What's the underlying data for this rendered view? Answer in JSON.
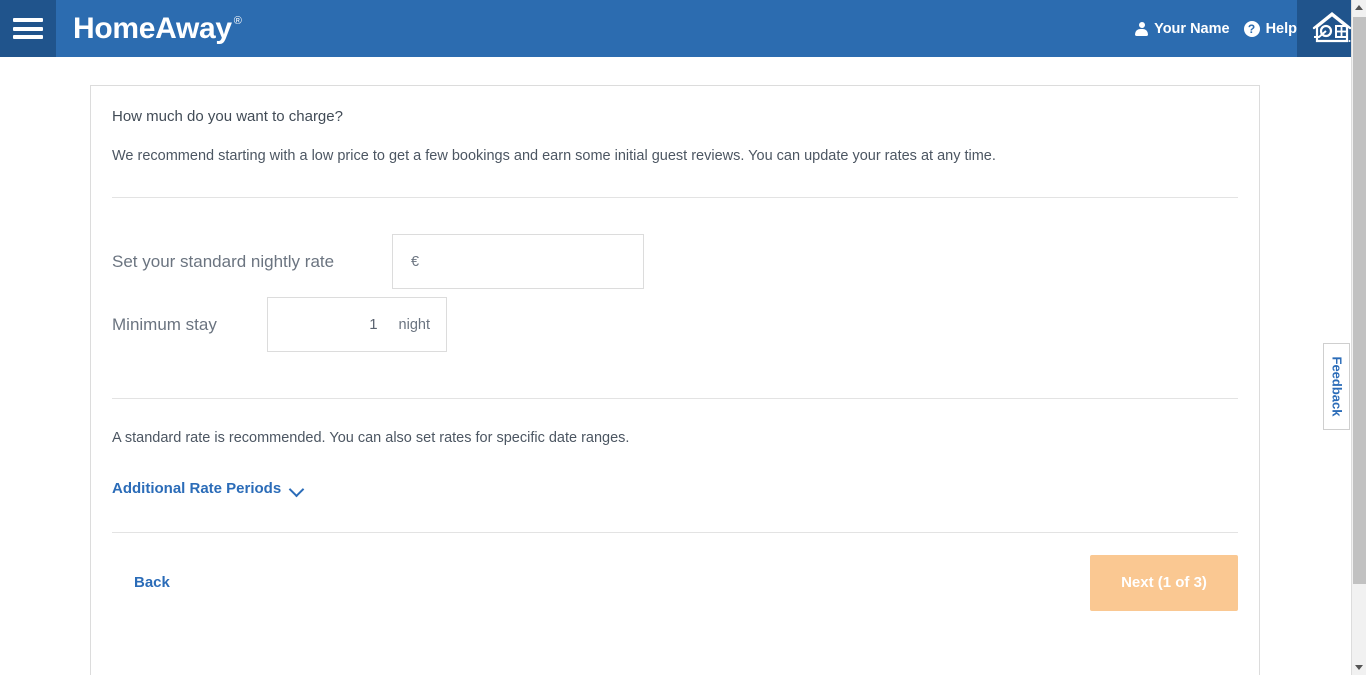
{
  "header": {
    "menu_icon": "hamburger-icon",
    "brand": "HomeAway",
    "brand_mark": "®",
    "account_label": "Your Name",
    "account_icon": "person-icon",
    "help_label": "Help",
    "help_icon": "question-mark-icon",
    "logo_icon": "homeaway-house-logo",
    "background_color": "#2c6cb0",
    "panel_color": "#20548c"
  },
  "card": {
    "title": "How much do you want to charge?",
    "subtitle": "We recommend starting with a low price to get a few bookings and earn some initial guest reviews. You can update your rates at any time.",
    "rate": {
      "label": "Set your standard nightly rate",
      "currency": "€",
      "value": "",
      "placeholder": ""
    },
    "minimum_stay": {
      "label": "Minimum stay",
      "value": "1",
      "unit": "night"
    },
    "note": "A standard rate is recommended. You can also set rates for specific date ranges.",
    "additional_rate_periods": {
      "label": "Additional Rate Periods",
      "chevron_icon": "chevron-down-icon"
    },
    "footer": {
      "back_label": "Back",
      "next_label": "Next (1 of 3)",
      "next_color": "#fac892",
      "link_color": "#2b6cb8"
    }
  },
  "feedback": {
    "label": "Feedback"
  },
  "scrollbar": {
    "up_icon": "scroll-up-arrow-icon",
    "down_icon": "scroll-down-arrow-icon"
  }
}
